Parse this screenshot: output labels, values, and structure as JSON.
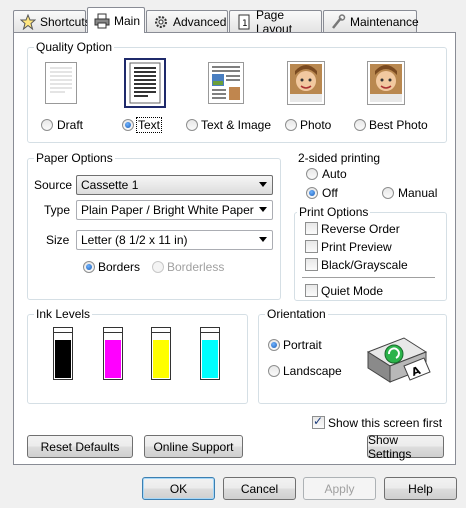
{
  "tabs": [
    {
      "label": "Shortcuts",
      "icon": "star-icon"
    },
    {
      "label": "Main",
      "icon": "printer-icon"
    },
    {
      "label": "Advanced",
      "icon": "gear-icon"
    },
    {
      "label": "Page Layout",
      "icon": "page-icon"
    },
    {
      "label": "Maintenance",
      "icon": "wrench-icon"
    }
  ],
  "quality": {
    "title": "Quality Option",
    "options": [
      {
        "label": "Draft",
        "selected": false
      },
      {
        "label": "Text",
        "selected": true
      },
      {
        "label": "Text & Image",
        "selected": false
      },
      {
        "label": "Photo",
        "selected": false
      },
      {
        "label": "Best Photo",
        "selected": false
      }
    ]
  },
  "paper": {
    "title": "Paper Options",
    "source_label": "Source",
    "source_value": "Cassette 1",
    "type_label": "Type",
    "type_value": "Plain Paper / Bright White Paper",
    "size_label": "Size",
    "size_value": "Letter (8 1/2 x 11 in)",
    "borders_label": "Borders",
    "borderless_label": "Borderless"
  },
  "two_sided": {
    "title": "2-sided printing",
    "auto_label": "Auto",
    "off_label": "Off",
    "manual_label": "Manual"
  },
  "print_options": {
    "title": "Print Options",
    "reverse_order": "Reverse Order",
    "print_preview": "Print Preview",
    "black_grayscale": "Black/Grayscale",
    "quiet_mode": "Quiet Mode"
  },
  "ink": {
    "title": "Ink Levels",
    "cartridges": [
      {
        "name": "black",
        "color": "#000000",
        "level": 0.8
      },
      {
        "name": "magenta",
        "color": "#ff00ff",
        "level": 0.8
      },
      {
        "name": "yellow",
        "color": "#ffff00",
        "level": 0.8
      },
      {
        "name": "cyan",
        "color": "#00ffff",
        "level": 0.8
      }
    ]
  },
  "orientation": {
    "title": "Orientation",
    "portrait_label": "Portrait",
    "landscape_label": "Landscape"
  },
  "show_screen_label": "Show this screen first",
  "buttons": {
    "reset_defaults": "Reset Defaults",
    "online_support": "Online Support",
    "show_settings": "Show Settings",
    "ok": "OK",
    "cancel": "Cancel",
    "apply": "Apply",
    "help": "Help"
  }
}
